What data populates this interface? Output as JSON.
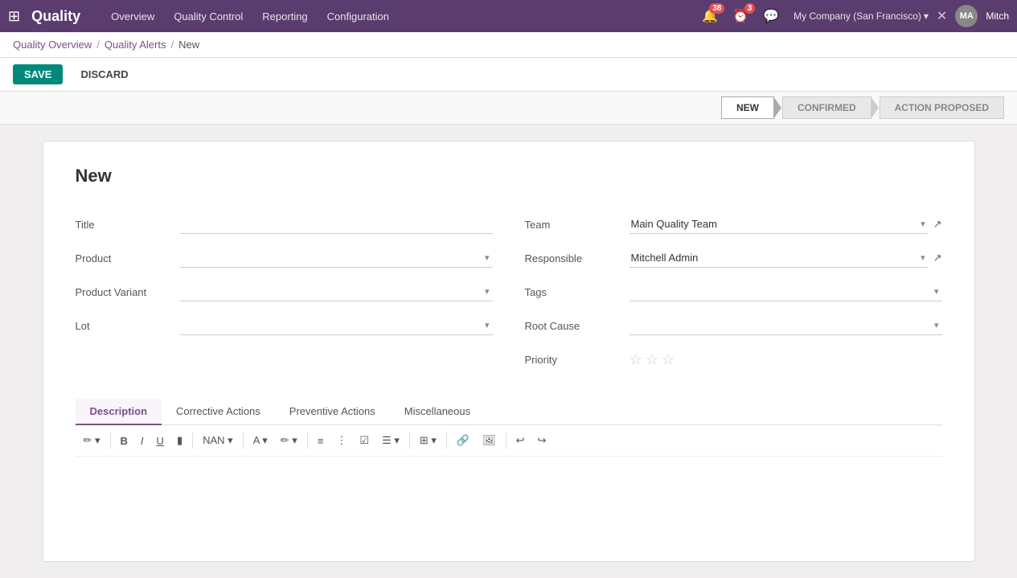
{
  "app": {
    "brand": "Quality",
    "menu": [
      "Overview",
      "Quality Control",
      "Reporting",
      "Configuration"
    ]
  },
  "topnav": {
    "notifications_count": "38",
    "messages_count": "3",
    "company": "My Company (San Francisco)",
    "user_initials": "MA",
    "user_name": "Mitch"
  },
  "breadcrumb": {
    "items": [
      "Quality Overview",
      "Quality Alerts"
    ],
    "current": "New"
  },
  "actions": {
    "save_label": "SAVE",
    "discard_label": "DISCARD"
  },
  "status": {
    "steps": [
      "NEW",
      "CONFIRMED",
      "ACTION PROPOSED"
    ],
    "active_step": 0
  },
  "form": {
    "title": "New",
    "left_fields": {
      "title_label": "Title",
      "title_value": "",
      "product_label": "Product",
      "product_value": "",
      "product_variant_label": "Product Variant",
      "product_variant_value": "",
      "lot_label": "Lot",
      "lot_value": ""
    },
    "right_fields": {
      "team_label": "Team",
      "team_value": "Main Quality Team",
      "responsible_label": "Responsible",
      "responsible_value": "Mitchell Admin",
      "tags_label": "Tags",
      "tags_value": "",
      "root_cause_label": "Root Cause",
      "root_cause_value": "",
      "priority_label": "Priority",
      "priority_stars": 0
    }
  },
  "tabs": [
    {
      "id": "description",
      "label": "Description",
      "active": true
    },
    {
      "id": "corrective",
      "label": "Corrective Actions",
      "active": false
    },
    {
      "id": "preventive",
      "label": "Preventive Actions",
      "active": false
    },
    {
      "id": "misc",
      "label": "Miscellaneous",
      "active": false
    }
  ],
  "toolbar": {
    "buttons": [
      {
        "id": "style",
        "label": "✏",
        "type": "dropdown"
      },
      {
        "id": "bold",
        "label": "B",
        "type": "bold"
      },
      {
        "id": "italic",
        "label": "I",
        "type": "italic"
      },
      {
        "id": "underline",
        "label": "U",
        "type": "underline"
      },
      {
        "id": "highlight",
        "label": "▮",
        "type": "normal"
      },
      {
        "id": "nan",
        "label": "NAN",
        "type": "dropdown"
      },
      {
        "id": "font-color",
        "label": "A",
        "type": "dropdown"
      },
      {
        "id": "bg-color",
        "label": "✏",
        "type": "dropdown"
      },
      {
        "id": "bullet-list",
        "label": "≡",
        "type": "normal"
      },
      {
        "id": "numbered-list",
        "label": "⋮",
        "type": "normal"
      },
      {
        "id": "checklist",
        "label": "☑",
        "type": "normal"
      },
      {
        "id": "align",
        "label": "☰",
        "type": "dropdown"
      },
      {
        "id": "table",
        "label": "⊞",
        "type": "dropdown"
      },
      {
        "id": "link",
        "label": "🔗",
        "type": "normal"
      },
      {
        "id": "image",
        "label": "🖼",
        "type": "normal"
      },
      {
        "id": "undo",
        "label": "↩",
        "type": "normal"
      },
      {
        "id": "redo",
        "label": "↪",
        "type": "normal"
      }
    ]
  }
}
